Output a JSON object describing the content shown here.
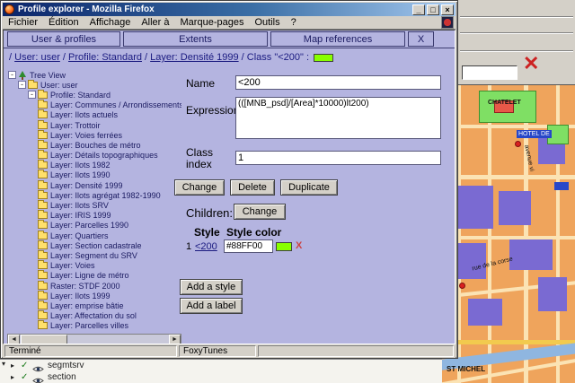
{
  "window": {
    "title": "Profile explorer - Mozilla Firefox",
    "menus": [
      "Fichier",
      "Édition",
      "Affichage",
      "Aller à",
      "Marque-pages",
      "Outils",
      "?"
    ],
    "status_left": "Terminé",
    "status_right": "FoxyTunes"
  },
  "icons": {
    "minimize": "_",
    "maximize": "□",
    "close": "×",
    "scroll_left": "◄",
    "scroll_right": "►",
    "expand_arrow": "▸",
    "check": "✓",
    "dropdown": "▾",
    "red_x": "✕",
    "collapse": "-"
  },
  "tabs": [
    {
      "label": "User & profiles"
    },
    {
      "label": "Extents"
    },
    {
      "label": "Map references"
    },
    {
      "label": "X"
    }
  ],
  "breadcrumb": {
    "leading": "/ ",
    "separator": " / ",
    "links": [
      "User: user",
      "Profile: Standard",
      "Layer: Densité 1999"
    ],
    "tail": "Class \"<200\"",
    "colon": " : ",
    "swatch_color": "#88FF00"
  },
  "tree": {
    "root": "Tree View",
    "user": "User: user",
    "profile": "Profile: Standard",
    "layers": [
      "Layer: Communes / Arrondissements",
      "Layer: Ilots actuels",
      "Layer: Trottoir",
      "Layer: Voies ferrées",
      "Layer: Bouches de métro",
      "Layer: Détails topographiques",
      "Layer: Ilots 1982",
      "Layer: Ilots 1990",
      "Layer: Densité 1999",
      "Layer: Ilots agrégat 1982-1990",
      "Layer: Ilots SRV",
      "Layer: IRIS 1999",
      "Layer: Parcelles 1990",
      "Layer: Quartiers",
      "Layer: Section cadastrale",
      "Layer: Segment du SRV",
      "Layer: Voies",
      "Layer: Ligne de métro",
      "Raster: STDF 2000",
      "Layer: Ilots 1999",
      "Layer: emprise bâtie",
      "Layer: Affectation du sol",
      "Layer: Parcelles villes"
    ]
  },
  "form": {
    "name_label": "Name",
    "name_value": "<200",
    "expression_label": "Expression",
    "expression_value": "(([MNB_psd]/[Area]*10000)lt200)",
    "class_index_label": "Class index",
    "class_index_value": "1",
    "buttons": {
      "change": "Change",
      "delete": "Delete",
      "duplicate": "Duplicate"
    },
    "children_label": "Children:",
    "children_change": "Change",
    "style_table": {
      "headers": [
        "Style",
        "Style color"
      ],
      "row": {
        "index": "1",
        "name": "<200",
        "color_value": "#88FF00",
        "color": "#88FF00",
        "remove": "X"
      }
    },
    "add_style": "Add a style",
    "add_label": "Add a label"
  },
  "background": {
    "map": {
      "labels": {
        "chatelet": "CHATELET",
        "hotel_de": "HOTEL DE",
        "avenue": "avenue vi",
        "rue_corse": "rue de la corse",
        "st_michel": "ST MICHEL"
      },
      "colors": {
        "base": "#efa45c",
        "block": "#7a6ad2",
        "park": "#7fdf64",
        "road": "#f2ca4e"
      }
    },
    "layers_panel": [
      {
        "label": "segmtsrv"
      },
      {
        "label": "section"
      }
    ]
  },
  "colors": {
    "page_bg": "#b4b4e0",
    "accent_green": "#88FF00"
  }
}
